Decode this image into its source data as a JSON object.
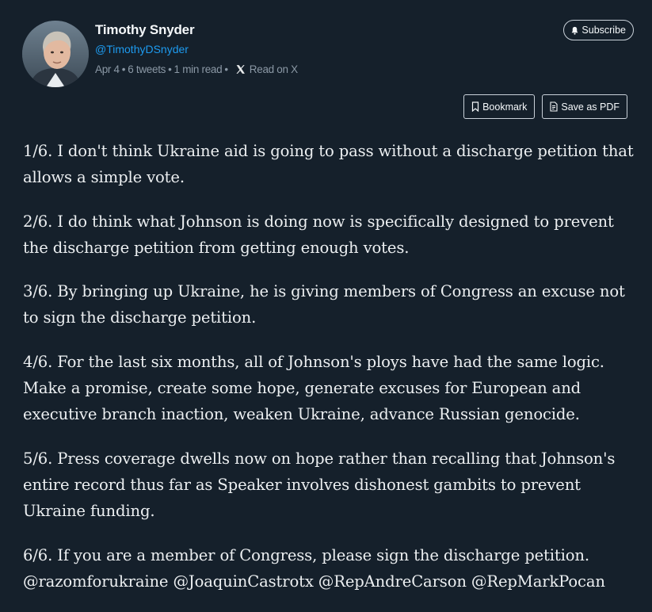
{
  "author": {
    "name": "Timothy Snyder",
    "handle": "@TimothyDSnyder"
  },
  "meta": {
    "date": "Apr 4",
    "tweet_count": "6 tweets",
    "read_time": "1 min read",
    "read_on": "Read on X",
    "separator": "•"
  },
  "buttons": {
    "subscribe": "Subscribe",
    "bookmark": "Bookmark",
    "save_pdf": "Save as PDF"
  },
  "tweets": [
    "1/6. I don't think Ukraine aid is going to pass without a discharge petition that allows a simple vote.",
    "2/6. I do think what Johnson is doing now is specifically designed to prevent the discharge petition from getting enough votes.",
    "3/6. By bringing up Ukraine, he is giving members of Congress an excuse not to sign the discharge petition.",
    "4/6. For the last six months, all of Johnson's ploys have had the same logic. Make a promise, create some hope, generate excuses for European and executive branch inaction, weaken Ukraine, advance Russian genocide.",
    "5/6. Press coverage dwells now on hope rather than recalling that Johnson's entire record thus far as Speaker involves dishonest gambits to prevent Ukraine funding.",
    "6/6. If you are a member of Congress, please sign the discharge petition. @razomforukraine @JoaquinCastrotx @RepAndreCarson @RepMarkPocan"
  ],
  "colors": {
    "background": "#15202b",
    "handle": "#1d9bf0",
    "muted": "#8b98a5",
    "text": "#eceff1"
  },
  "icons": {
    "bell": "bell-icon",
    "bookmark": "bookmark-icon",
    "pdf": "pdf-icon",
    "x_logo": "x-logo-icon"
  }
}
